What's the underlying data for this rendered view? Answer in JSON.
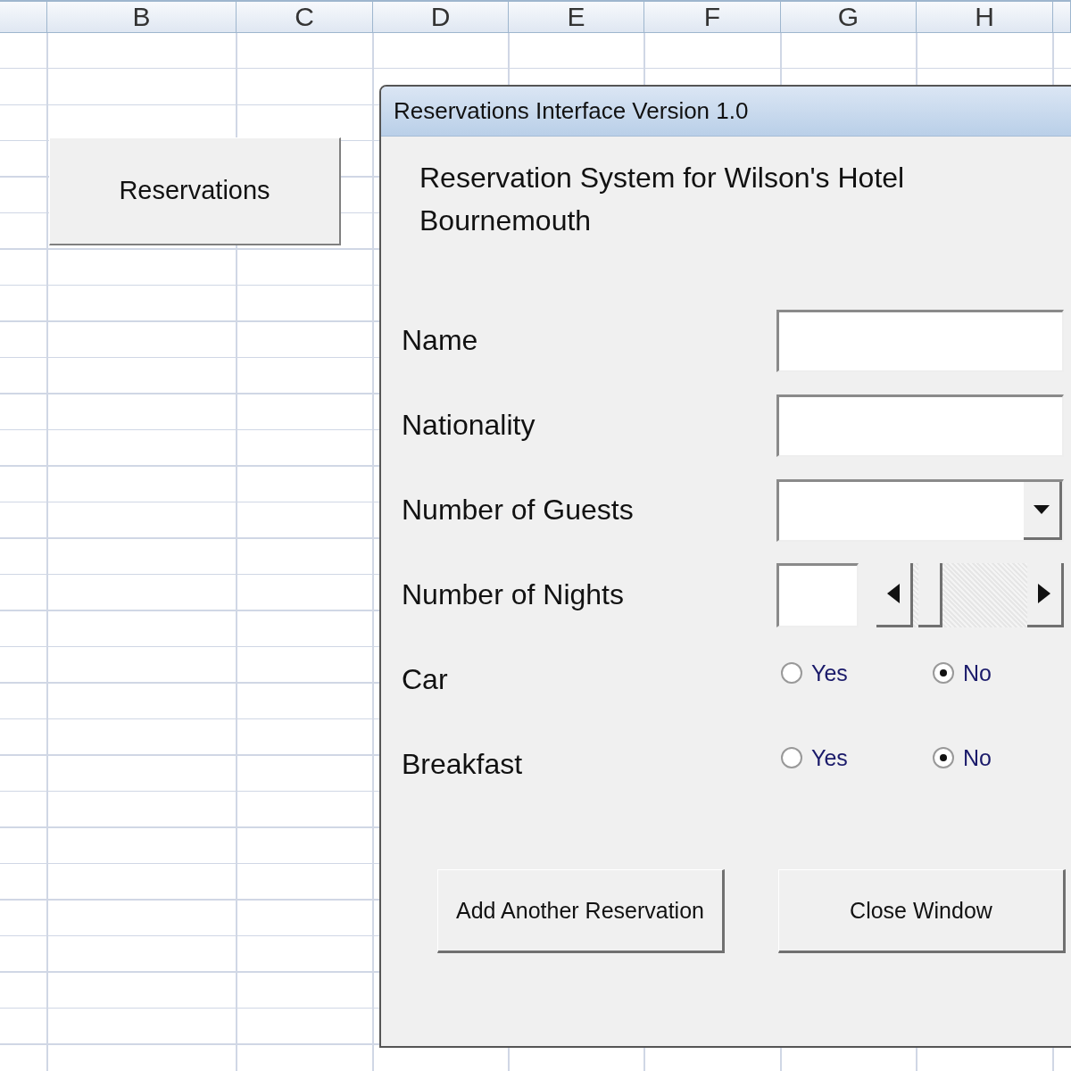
{
  "sheet": {
    "columns": [
      "",
      "B",
      "C",
      "D",
      "E",
      "F",
      "G",
      "H"
    ],
    "button": {
      "label": "Reservations"
    }
  },
  "dialog": {
    "title": "Reservations Interface Version 1.0",
    "heading": "Reservation System for Wilson's Hotel Bournemouth",
    "fields": [
      {
        "kind": "text",
        "label": "Name"
      },
      {
        "kind": "text",
        "label": "Nationality"
      },
      {
        "kind": "combo",
        "label": "Number of Guests"
      },
      {
        "kind": "spin",
        "label": "Number of Nights"
      },
      {
        "kind": "radio",
        "label": "Car",
        "options": [
          {
            "label": "Yes",
            "selected": false
          },
          {
            "label": "No",
            "selected": true
          }
        ]
      },
      {
        "kind": "radio",
        "label": "Breakfast",
        "options": [
          {
            "label": "Yes",
            "selected": false
          },
          {
            "label": "No",
            "selected": true
          }
        ]
      }
    ],
    "buttons": [
      "Add Another Reservation",
      "Close Window"
    ]
  }
}
